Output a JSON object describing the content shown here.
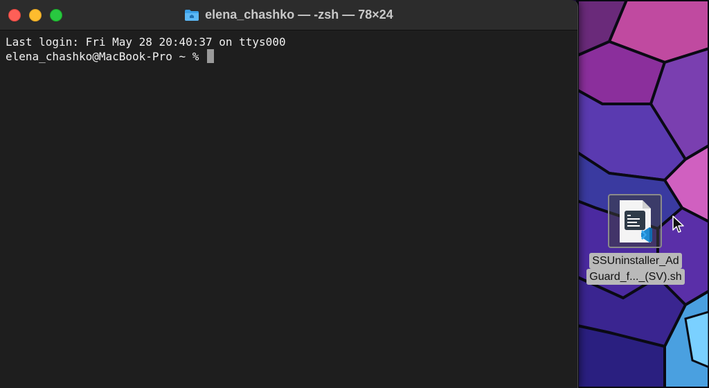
{
  "window": {
    "title": "elena_chashko — -zsh — 78×24",
    "title_icon": "folder-home-icon"
  },
  "terminal": {
    "lines": [
      "Last login: Fri May 28 20:40:37 on ttys000",
      "elena_chashko@MacBook-Pro ~ % "
    ]
  },
  "desktop": {
    "file": {
      "name_line1": "SSUninstaller_Ad",
      "name_line2": "Guard_f..._(SV).sh",
      "icon": "shell-script-file-icon",
      "badge_icon": "vscode-icon"
    }
  },
  "colors": {
    "terminal_bg": "#1e1e1e",
    "titlebar_bg": "#2c2c2c",
    "close": "#fe5f57",
    "minimize": "#febc2e",
    "zoom": "#28c840"
  }
}
